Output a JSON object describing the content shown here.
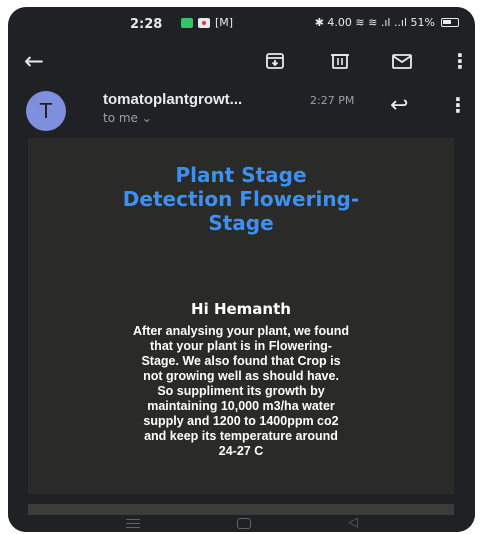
{
  "status_bar": {
    "time": "2:28",
    "left_icons_text": "[M]",
    "right_text": "✱ 4.00 ≋ ≋ .ıl ..ıl 51%"
  },
  "sender": {
    "avatar_letter": "T",
    "name": "tomatoplantgrowt...",
    "time": "2:27 PM",
    "to_me": "to me ⌄"
  },
  "email": {
    "headline_lines": [
      "Plant Stage",
      "Detection Flowering-",
      "Stage"
    ],
    "greeting": "Hi Hemanth",
    "message_lines": [
      "After analysing your plant, we found",
      "that your plant is in Flowering-",
      "Stage. We also found that Crop is",
      "not growing well as should have.",
      "So suppliment its growth by",
      "maintaining 10,000 m3/ha water",
      "supply and 1200 to 1400ppm co2",
      "and keep its temperature around",
      "24-27 C"
    ]
  },
  "icons": {
    "back": "arrow-left",
    "archive": "archive",
    "delete": "trash",
    "mail": "envelope",
    "more": "vertical-dots",
    "reply": "reply-arrow"
  },
  "colors": {
    "background": "#202124",
    "card": "#2a2a29",
    "headline": "#3f8ff2",
    "avatar": "#7f8fde",
    "text": "#ffffff"
  }
}
